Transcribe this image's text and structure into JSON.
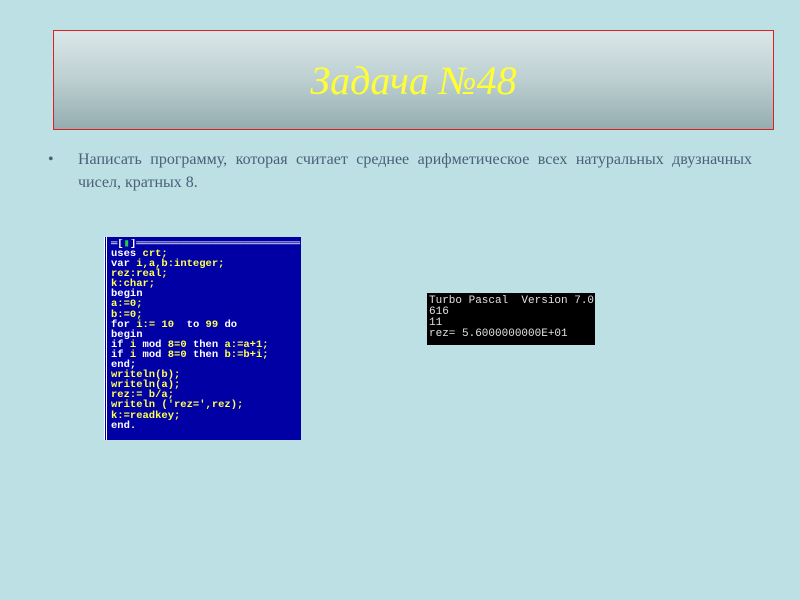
{
  "slide": {
    "title": "Задача №48",
    "bullet_symbol": "•",
    "bullet_text": "Написать программу, которая считает среднее арифметическое всех натуральных двузначных чисел, кратных 8."
  },
  "code_window": {
    "frame_left": "═[",
    "frame_mark": "▮",
    "frame_right": "]══════════════════════════",
    "lines": [
      [
        {
          "t": "uses ",
          "k": "w"
        },
        {
          "t": "crt;",
          "k": "y"
        }
      ],
      [
        {
          "t": "var ",
          "k": "w"
        },
        {
          "t": "i,a,b:integer;",
          "k": "y"
        }
      ],
      [
        {
          "t": "rez:real;",
          "k": "y"
        }
      ],
      [
        {
          "t": "k:char;",
          "k": "y"
        }
      ],
      [
        {
          "t": "begin",
          "k": "w"
        }
      ],
      [
        {
          "t": "a:=0;",
          "k": "y"
        }
      ],
      [
        {
          "t": "b:=0;",
          "k": "y"
        }
      ],
      [
        {
          "t": "for ",
          "k": "w"
        },
        {
          "t": "i:= 10  ",
          "k": "y"
        },
        {
          "t": "to ",
          "k": "w"
        },
        {
          "t": "99 ",
          "k": "y"
        },
        {
          "t": "do",
          "k": "w"
        }
      ],
      [
        {
          "t": "begin",
          "k": "w"
        }
      ],
      [
        {
          "t": "if ",
          "k": "w"
        },
        {
          "t": "i ",
          "k": "y"
        },
        {
          "t": "mod ",
          "k": "w"
        },
        {
          "t": "8=0 ",
          "k": "y"
        },
        {
          "t": "then ",
          "k": "w"
        },
        {
          "t": "a:=a+1;",
          "k": "y"
        }
      ],
      [
        {
          "t": "if ",
          "k": "w"
        },
        {
          "t": "i ",
          "k": "y"
        },
        {
          "t": "mod ",
          "k": "w"
        },
        {
          "t": "8=0 ",
          "k": "y"
        },
        {
          "t": "then ",
          "k": "w"
        },
        {
          "t": "b:=b+i;",
          "k": "y"
        }
      ],
      [
        {
          "t": "end;",
          "k": "w"
        }
      ],
      [
        {
          "t": "writeln(b);",
          "k": "y"
        }
      ],
      [
        {
          "t": "writeln(a);",
          "k": "y"
        }
      ],
      [
        {
          "t": "rez:= b/a;",
          "k": "y"
        }
      ],
      [
        {
          "t": "writeln ('rez=',rez);",
          "k": "y"
        }
      ],
      [
        {
          "t": "k:=readkey;",
          "k": "y"
        }
      ],
      [
        {
          "t": "end.",
          "k": "w"
        }
      ]
    ]
  },
  "console": {
    "lines": [
      "Turbo Pascal  Version 7.0",
      "616",
      "11",
      "rez= 5.6000000000E+01"
    ]
  },
  "colors": {
    "background": "#bde0e4",
    "title": "#ffff33",
    "code_bg": "#0000a4",
    "title_border": "#e02020"
  }
}
